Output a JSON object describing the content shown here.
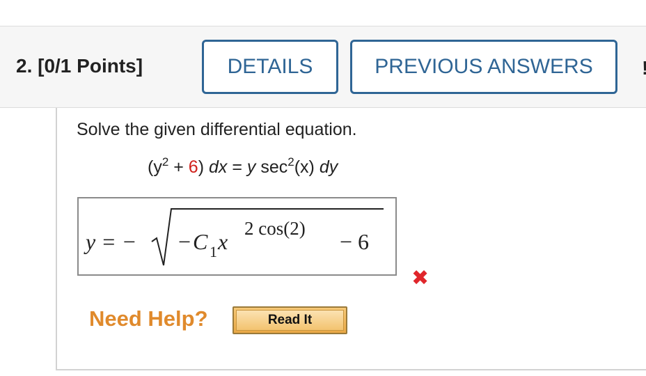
{
  "question": {
    "title": "2. [0/1 Points]",
    "details_label": "DETAILS",
    "previous_answers_label": "PREVIOUS ANSWERS"
  },
  "problem": {
    "prompt": "Solve the given differential equation.",
    "equation": {
      "open": "(y",
      "exp1": "2",
      "plus": " + ",
      "six": "6",
      "mid": ") ",
      "dx": "dx",
      "eq": " = ",
      "y": "y",
      "sec": " sec",
      "exp2": "2",
      "x": "(x) ",
      "dy": "dy"
    }
  },
  "answer": {
    "lhs": "y = −",
    "inner_sign": "−",
    "c": "C",
    "c_sub": "1",
    "x": "x",
    "exponent": "2 cos(2)",
    "minus6": "− 6",
    "status": "incorrect",
    "status_color": "#e0262b"
  },
  "help": {
    "label": "Need Help?",
    "read_it_label": "Read It"
  },
  "colors": {
    "accent": "#2f6595",
    "help": "#e08a2c",
    "incorrect": "#e0262b"
  }
}
